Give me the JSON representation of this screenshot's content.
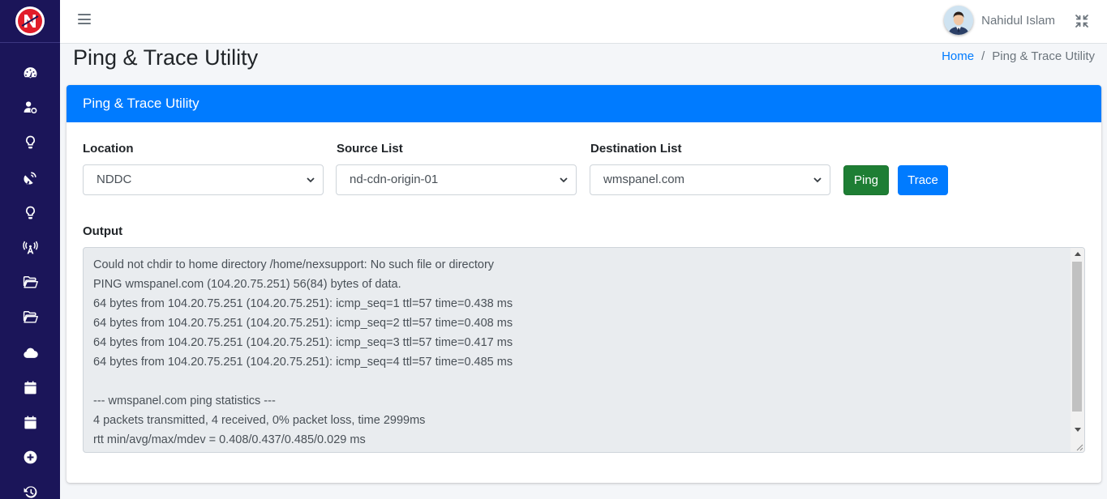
{
  "app": {
    "logo_letter": "N"
  },
  "sidebar": {
    "items": [
      {
        "icon": "dashboard-gauge-icon"
      },
      {
        "icon": "user-cog-icon"
      },
      {
        "icon": "lightbulb-icon"
      },
      {
        "icon": "satellite-dish-icon"
      },
      {
        "icon": "lightbulb-icon"
      },
      {
        "icon": "broadcast-tower-icon"
      },
      {
        "icon": "folder-open-icon"
      },
      {
        "icon": "folder-open-icon"
      },
      {
        "icon": "cloud-icon"
      },
      {
        "icon": "calendar-icon"
      },
      {
        "icon": "calendar-icon"
      },
      {
        "icon": "plus-circle-icon"
      },
      {
        "icon": "history-icon"
      }
    ]
  },
  "header": {
    "user_name": "Nahidul Islam"
  },
  "page": {
    "title": "Ping & Trace Utility",
    "breadcrumb": {
      "home": "Home",
      "separator": "/",
      "current": "Ping & Trace Utility"
    }
  },
  "card": {
    "title": "Ping & Trace Utility",
    "location": {
      "label": "Location",
      "value": "NDDC"
    },
    "source": {
      "label": "Source List",
      "value": "nd-cdn-origin-01"
    },
    "destination": {
      "label": "Destination List",
      "value": "wmspanel.com"
    },
    "ping_label": "Ping",
    "trace_label": "Trace",
    "output_label": "Output",
    "output": "Could not chdir to home directory /home/nexsupport: No such file or directory\nPING wmspanel.com (104.20.75.251) 56(84) bytes of data.\n64 bytes from 104.20.75.251 (104.20.75.251): icmp_seq=1 ttl=57 time=0.438 ms\n64 bytes from 104.20.75.251 (104.20.75.251): icmp_seq=2 ttl=57 time=0.408 ms\n64 bytes from 104.20.75.251 (104.20.75.251): icmp_seq=3 ttl=57 time=0.417 ms\n64 bytes from 104.20.75.251 (104.20.75.251): icmp_seq=4 ttl=57 time=0.485 ms\n\n--- wmspanel.com ping statistics ---\n4 packets transmitted, 4 received, 0% packet loss, time 2999ms\nrtt min/avg/max/mdev = 0.408/0.437/0.485/0.029 ms"
  },
  "colors": {
    "sidebar": "#1b1559",
    "primary": "#007bff",
    "success": "#1e7e34",
    "logo_red": "#e11d2a"
  }
}
